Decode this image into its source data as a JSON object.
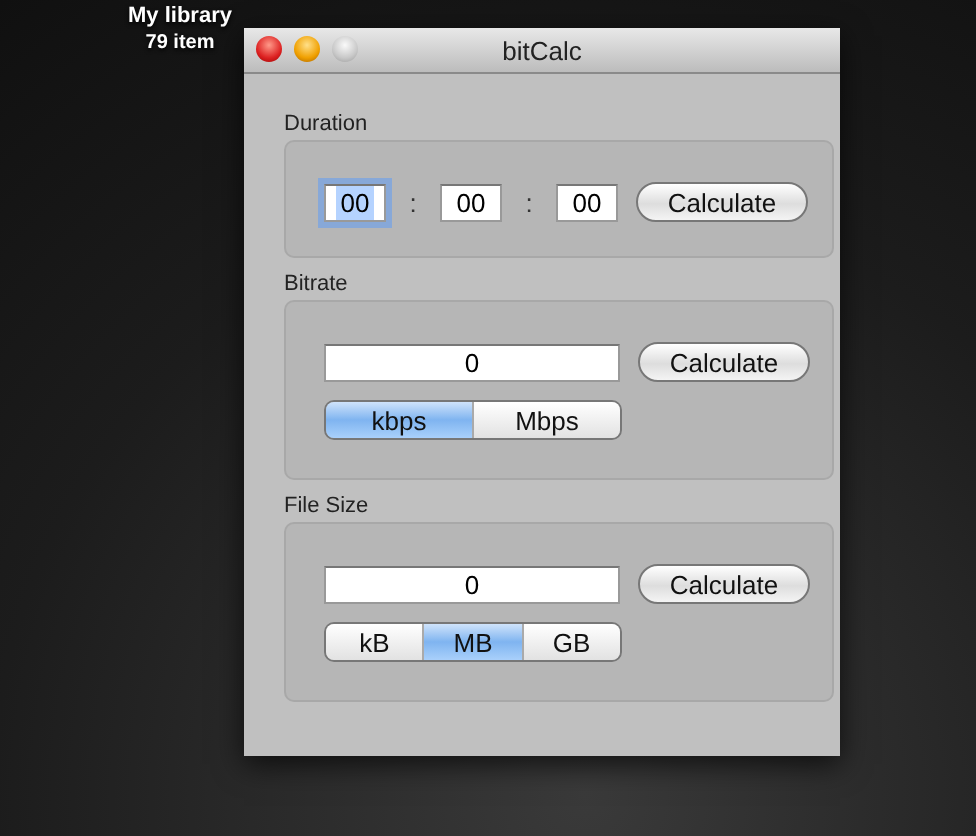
{
  "desktop_icon": {
    "title": "My library",
    "subtitle": "79 item"
  },
  "window": {
    "title": "bitCalc",
    "buttons": [
      {
        "kind": "close"
      },
      {
        "kind": "minimize"
      },
      {
        "kind": "zoom"
      }
    ]
  },
  "sections": [
    {
      "label": "Duration",
      "kind": "duration",
      "fields": [
        {
          "value": "00",
          "focused": true
        },
        {
          "value": "00",
          "focused": false
        },
        {
          "value": "00",
          "focused": false
        }
      ],
      "separators": [
        ":",
        ":"
      ],
      "button": "Calculate"
    },
    {
      "label": "Bitrate",
      "kind": "value",
      "field": "0",
      "button": "Calculate",
      "units": [
        {
          "label": "kbps",
          "selected": true
        },
        {
          "label": "Mbps",
          "selected": false
        }
      ]
    },
    {
      "label": "File Size",
      "kind": "value",
      "field": "0",
      "button": "Calculate",
      "units": [
        {
          "label": "kB",
          "selected": false
        },
        {
          "label": "MB",
          "selected": true
        },
        {
          "label": "GB",
          "selected": false
        }
      ]
    }
  ]
}
